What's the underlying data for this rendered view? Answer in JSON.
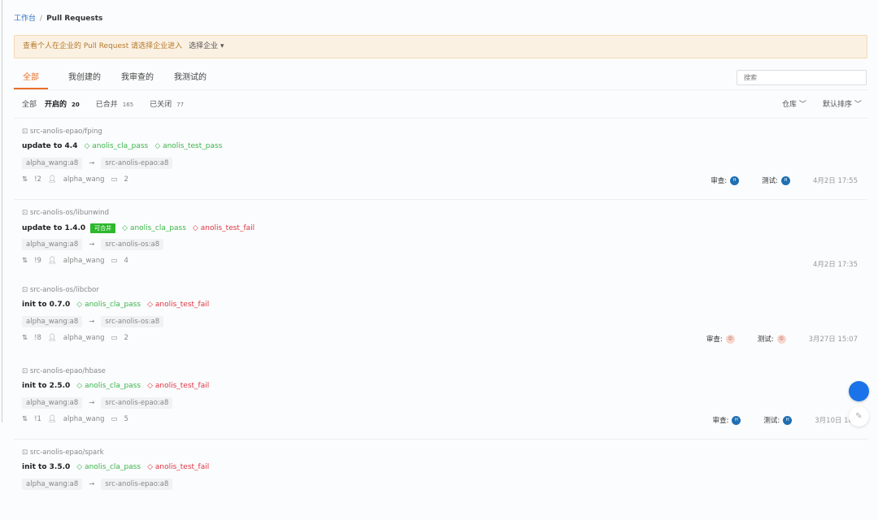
{
  "breadcrumb": {
    "home": "工作台",
    "current": "Pull Requests"
  },
  "banner": {
    "text": "查看个人在企业的 Pull Request 请选择企业进入",
    "select": "选择企业 ▾"
  },
  "tabs": [
    "全部",
    "我创建的",
    "我审查的",
    "我测试的"
  ],
  "search": {
    "placeholder": "搜索"
  },
  "filters": {
    "all": "全部",
    "open": "开启的",
    "open_count": "20",
    "merged": "已合并",
    "merged_count": "165",
    "closed": "已关闭",
    "closed_count": "77"
  },
  "sort": {
    "repo": "仓库 ﹀",
    "order": "默认排序 ﹀"
  },
  "labels": {
    "review": "审查:",
    "test": "测试:"
  },
  "colors": {
    "accent": "#e8702a",
    "pass": "#3bb54a",
    "fail": "#e0343f",
    "badge": "#2eb82e"
  },
  "items": [
    {
      "repo": "src-anolis-epao/fping",
      "title": "update to 4.4",
      "badge": "",
      "tags": [
        {
          "t": "anolis_cla_pass",
          "s": "pass"
        },
        {
          "t": "anolis_test_pass",
          "s": "pass"
        }
      ],
      "from": "alpha_wang:a8",
      "to": "src-anolis-epao:a8",
      "num": "!2",
      "author": "alpha_wang",
      "comments": "2",
      "reviewers": true,
      "avatar": "blue",
      "time": "4月2日 17:55"
    },
    {
      "repo": "src-anolis-os/libunwind",
      "title": "update to 1.4.0",
      "badge": "可合并",
      "tags": [
        {
          "t": "anolis_cla_pass",
          "s": "pass"
        },
        {
          "t": "anolis_test_fail",
          "s": "fail"
        }
      ],
      "from": "alpha_wang:a8",
      "to": "src-anolis-os:a8",
      "num": "!9",
      "author": "alpha_wang",
      "comments": "4",
      "reviewers": false,
      "time": "4月2日 17:35"
    },
    {
      "repo": "src-anolis-os/libcbor",
      "title": "init to 0.7.0",
      "badge": "",
      "tags": [
        {
          "t": "anolis_cla_pass",
          "s": "pass"
        },
        {
          "t": "anolis_test_fail",
          "s": "fail"
        }
      ],
      "from": "alpha_wang:a8",
      "to": "src-anolis-os:a8",
      "num": "!8",
      "author": "alpha_wang",
      "comments": "2",
      "reviewers": true,
      "avatar": "pink",
      "time": "3月27日 15:07"
    },
    {
      "repo": "src-anolis-epao/hbase",
      "title": "init to 2.5.0",
      "badge": "",
      "tags": [
        {
          "t": "anolis_cla_pass",
          "s": "pass"
        },
        {
          "t": "anolis_test_fail",
          "s": "fail"
        }
      ],
      "from": "alpha_wang:a8",
      "to": "src-anolis-epao:a8",
      "num": "!1",
      "author": "alpha_wang",
      "comments": "5",
      "reviewers": true,
      "avatar": "blue",
      "time": "3月10日 18"
    },
    {
      "repo": "src-anolis-epao/spark",
      "title": "init to 3.5.0",
      "badge": "",
      "tags": [
        {
          "t": "anolis_cla_pass",
          "s": "pass"
        },
        {
          "t": "anolis_test_fail",
          "s": "fail"
        }
      ],
      "from": "alpha_wang:a8",
      "to": "src-anolis-epao:a8",
      "num": "",
      "author": "",
      "comments": "",
      "reviewers": false,
      "time": ""
    }
  ]
}
